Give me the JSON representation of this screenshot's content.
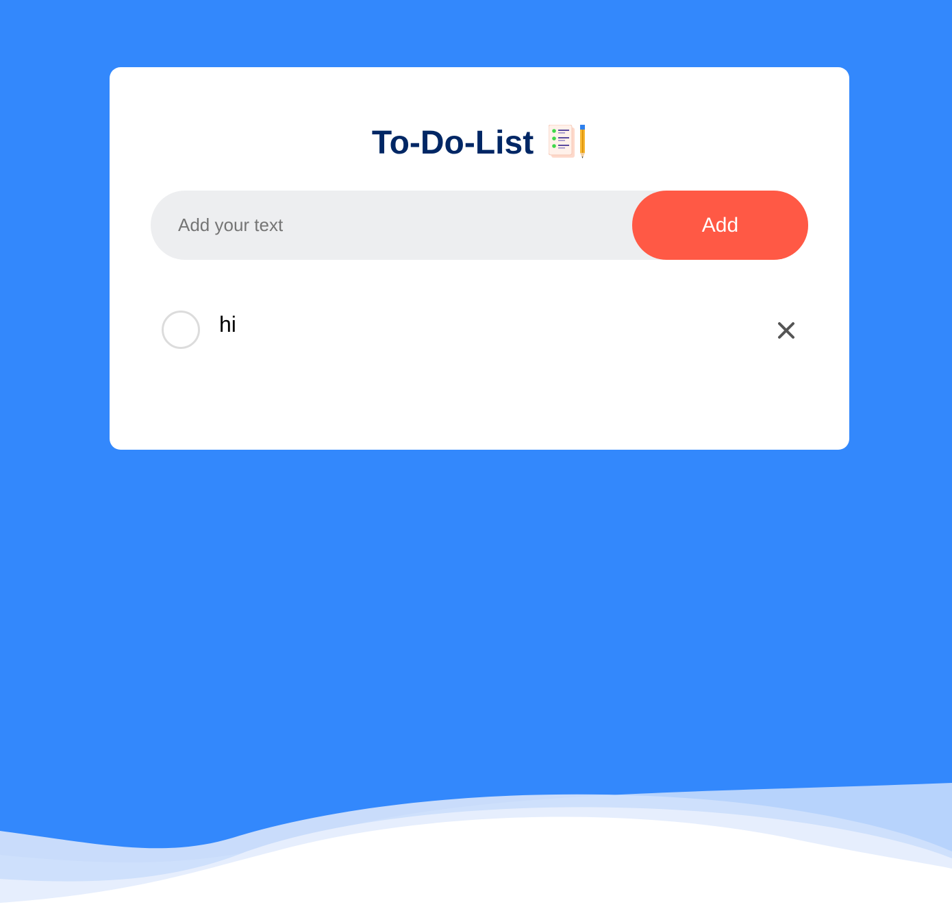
{
  "app": {
    "title": "To-Do-List",
    "title_icon": "notepad-pencil-icon"
  },
  "input": {
    "value": "",
    "placeholder": "Add your text"
  },
  "add_button": {
    "label": "Add"
  },
  "todos": [
    {
      "text": "hi",
      "checked": false
    }
  ],
  "icons": {
    "checkbox": "circle-checkbox-icon",
    "delete": "close-icon"
  },
  "colors": {
    "background": "#3388fc",
    "title": "#002765",
    "accent": "#ff5945",
    "input_bg": "#edeef0"
  }
}
